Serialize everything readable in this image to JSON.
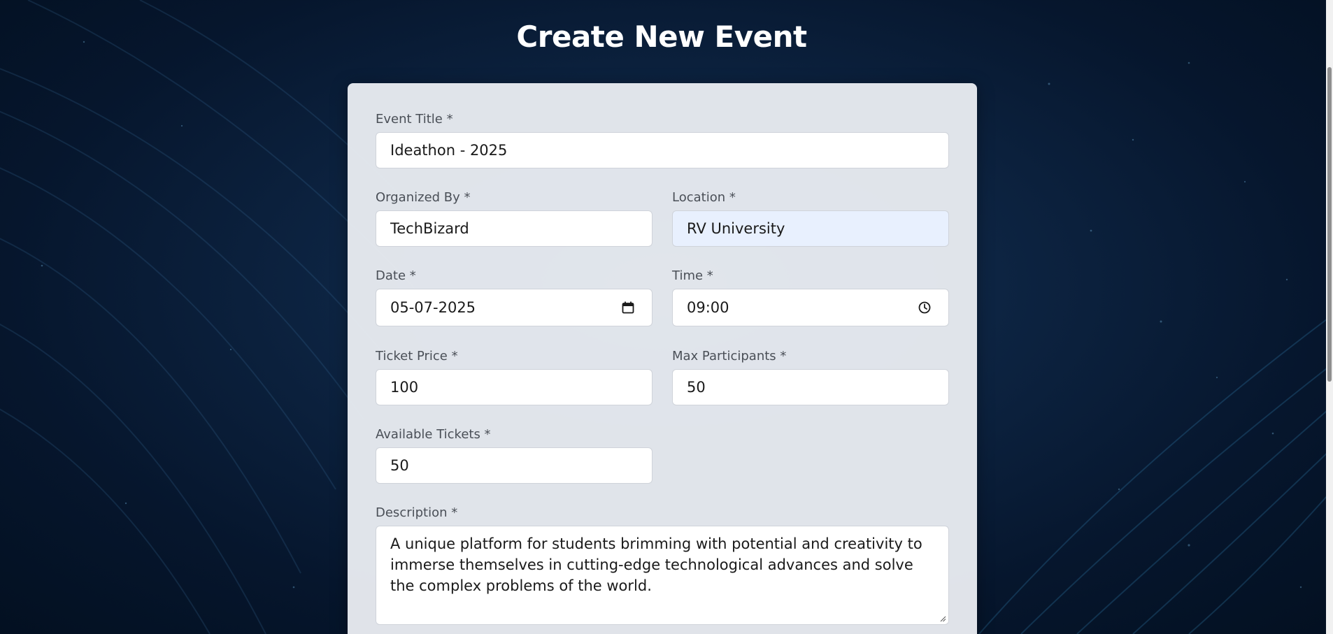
{
  "page": {
    "title": "Create New Event"
  },
  "form": {
    "event_title": {
      "label": "Event Title *",
      "value": "Ideathon - 2025"
    },
    "organized_by": {
      "label": "Organized By *",
      "value": "TechBizard"
    },
    "location": {
      "label": "Location *",
      "value": "RV University"
    },
    "date": {
      "label": "Date *",
      "value": "05-07-2025",
      "icon": "calendar-icon"
    },
    "time": {
      "label": "Time *",
      "value": "09:00",
      "icon": "clock-icon"
    },
    "ticket_price": {
      "label": "Ticket Price *",
      "value": "100"
    },
    "max_participants": {
      "label": "Max Participants *",
      "value": "50"
    },
    "available_tickets": {
      "label": "Available Tickets *",
      "value": "50"
    },
    "description": {
      "label": "Description *",
      "value": "A unique platform for students brimming with potential and creativity to immerse themselves in cutting-edge technological advances and solve the complex problems of the world."
    }
  },
  "colors": {
    "background": "#0d2442",
    "card": "#e9ecf1",
    "autofill": "#e8f0fe"
  }
}
